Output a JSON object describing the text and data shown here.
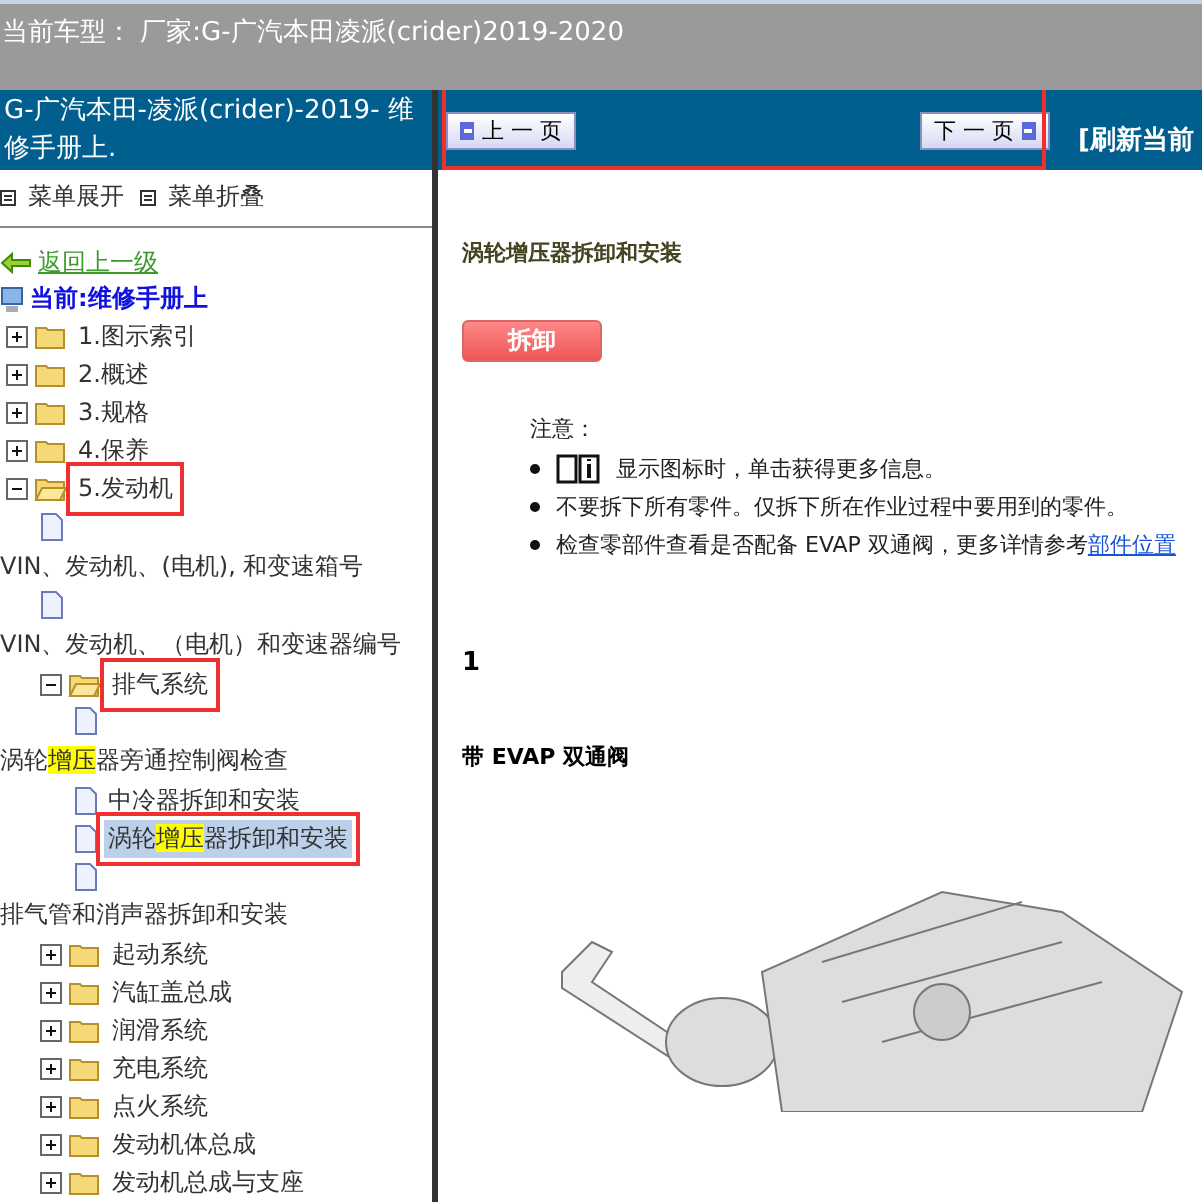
{
  "top_bar": {
    "title": "当前车型： 厂家:G-广汽本田凌派(crider)2019-2020"
  },
  "sidebar": {
    "header": "G-广汽本田-凌派(crider)-2019- 维修手册上.",
    "menu_buttons": [
      {
        "label": "菜单展开"
      },
      {
        "label": "菜单折叠"
      }
    ],
    "back_link": "返回上一级",
    "current": "当前:维修手册上",
    "tree": [
      {
        "kind": "folder",
        "label": "1.图示索引",
        "expanded": false,
        "marked": false
      },
      {
        "kind": "folder",
        "label": "2.概述",
        "expanded": false,
        "marked": false
      },
      {
        "kind": "folder",
        "label": "3.规格",
        "expanded": false,
        "marked": false
      },
      {
        "kind": "folder",
        "label": "4.保养",
        "expanded": false,
        "marked": false
      },
      {
        "kind": "folder",
        "label": "5.发动机",
        "expanded": true,
        "marked": true,
        "children": [
          {
            "kind": "doc-wrap",
            "label": "VIN、发动机、(电机), 和变速箱号",
            "selected": false
          },
          {
            "kind": "doc-wrap",
            "label": "VIN、发动机、（电机）和变速器编号",
            "selected": false
          },
          {
            "kind": "folder",
            "label": "排气系统",
            "expanded": true,
            "marked": true,
            "children": [
              {
                "kind": "doc-wrap",
                "label": "涡轮**增压**器旁通控制阀检查",
                "selected": false
              },
              {
                "kind": "doc",
                "label": "中冷器拆卸和安装",
                "selected": false,
                "marked": false
              },
              {
                "kind": "doc",
                "label": "涡轮**增压**器拆卸和安装",
                "selected": true,
                "marked": true
              },
              {
                "kind": "doc-wrap",
                "label": "排气管和消声器拆卸和安装",
                "selected": false
              }
            ]
          },
          {
            "kind": "folder",
            "label": "起动系统",
            "expanded": false,
            "marked": false
          },
          {
            "kind": "folder",
            "label": "汽缸盖总成",
            "expanded": false,
            "marked": false
          },
          {
            "kind": "folder",
            "label": "润滑系统",
            "expanded": false,
            "marked": false
          },
          {
            "kind": "folder",
            "label": "充电系统",
            "expanded": false,
            "marked": false
          },
          {
            "kind": "folder",
            "label": "点火系统",
            "expanded": false,
            "marked": false
          },
          {
            "kind": "folder",
            "label": "发动机体总成",
            "expanded": false,
            "marked": false
          },
          {
            "kind": "folder",
            "label": "发动机总成与支座",
            "expanded": false,
            "marked": false
          }
        ]
      }
    ]
  },
  "content": {
    "nav": {
      "marked": true,
      "prev": "上 一 页",
      "next": "下 一 页",
      "refresh": "[刷新当前"
    },
    "title": "涡轮增压器拆卸和安装",
    "action_button": "拆卸",
    "note_label": "注意：",
    "notes": [
      {
        "icon": true,
        "text": "显示图标时，单击获得更多信息。"
      },
      {
        "icon": false,
        "text": "不要拆下所有零件。仅拆下所在作业过程中要用到的零件。"
      },
      {
        "icon": false,
        "text": "检查零部件查看是否配备 EVAP 双通阀，更多详情参考",
        "link": "部件位置"
      }
    ],
    "step": "1",
    "subheading": "带 EVAP 双通阀"
  }
}
